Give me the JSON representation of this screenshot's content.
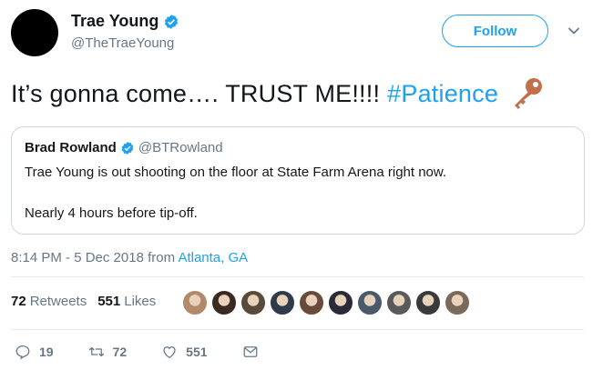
{
  "author": {
    "display_name": "Trae Young",
    "handle": "@TheTraeYoung",
    "verified": true
  },
  "follow_button": {
    "label": "Follow"
  },
  "tweet": {
    "text": "It’s gonna come…. TRUST ME!!!!",
    "hashtag": "#Patience",
    "emoji_icon": "key-icon"
  },
  "quoted_tweet": {
    "display_name": "Brad Rowland",
    "handle": "@BTRowland",
    "line1": "Trae Young is out shooting on the floor at State Farm Arena right now.",
    "line2": "Nearly 4 hours before tip-off."
  },
  "meta": {
    "timestamp": "8:14 PM - 5 Dec 2018 from",
    "location": "Atlanta, GA"
  },
  "stats": {
    "retweets_count": "72",
    "retweets_label": "Retweets",
    "likes_count": "551",
    "likes_label": "Likes"
  },
  "likers": [
    "#b08a6a",
    "#3a2a22",
    "#5a4a3a",
    "#2f3a4a",
    "#6a4a3a",
    "#2a2a3a",
    "#4a5a6a",
    "#5a5a5a",
    "#3a3a3a",
    "#7a6a5a"
  ],
  "actions": {
    "replies": "19",
    "retweets": "72",
    "likes": "551"
  },
  "colors": {
    "accent": "#1da1f2",
    "text": "#14171a",
    "secondary": "#657786",
    "border": "#ccd6dd"
  }
}
